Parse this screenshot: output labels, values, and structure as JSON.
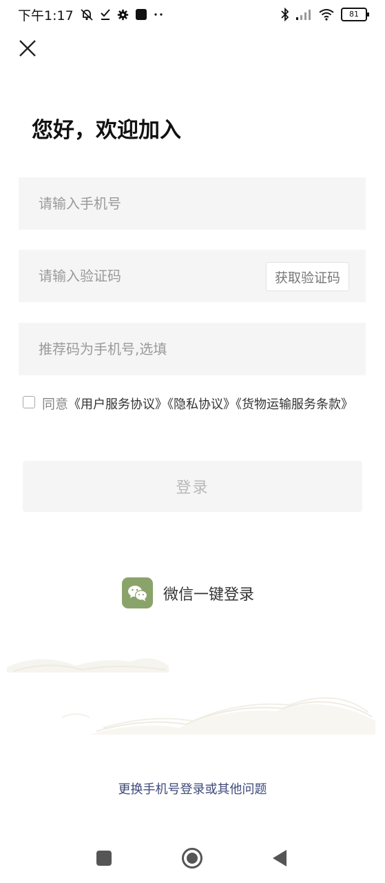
{
  "status_bar": {
    "time": "下午1:17",
    "battery": "81",
    "icons": [
      "mute-bell-icon",
      "download-check-icon",
      "gear-icon",
      "app-square-icon",
      "more-dots-icon",
      "bluetooth-icon",
      "signal-icon",
      "wifi-icon",
      "battery-icon"
    ]
  },
  "header": {
    "close_icon": "close-icon"
  },
  "title": "您好，欢迎加入",
  "form": {
    "phone_placeholder": "请输入手机号",
    "code_placeholder": "请输入验证码",
    "get_code_label": "获取验证码",
    "referral_placeholder": "推荐码为手机号,选填"
  },
  "agreement": {
    "prefix": "同意",
    "docs": [
      "《用户服务协议》",
      "《隐私协议》",
      "《货物运输服务条款》"
    ]
  },
  "login_label": "登录",
  "wechat_login_label": "微信一键登录",
  "other_issue_link": "更换手机号登录或其他问题",
  "nav": {
    "icons": [
      "recent-apps-icon",
      "home-icon",
      "back-icon"
    ]
  },
  "colors": {
    "accent_link": "#3e4a7a",
    "wechat_green": "#8aa36a",
    "field_bg": "#f5f5f5"
  }
}
